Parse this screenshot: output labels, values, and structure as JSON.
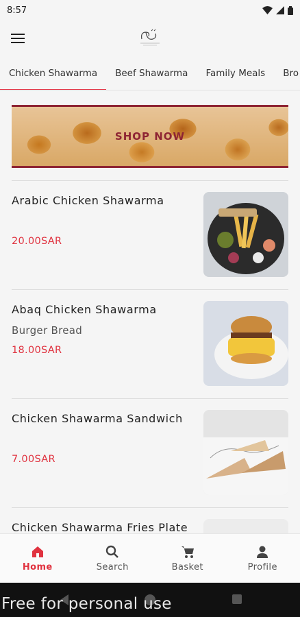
{
  "status_bar": {
    "time": "8:57"
  },
  "header": {
    "logo_icon": "brand-logo-icon",
    "menu_icon": "hamburger-menu-icon"
  },
  "tabs": [
    {
      "label": "Chicken Shawarma",
      "active": true
    },
    {
      "label": "Beef Shawarma",
      "active": false
    },
    {
      "label": "Family Meals",
      "active": false
    },
    {
      "label": "Bro",
      "active": false
    }
  ],
  "banner": {
    "label": "SHOP NOW"
  },
  "products": [
    {
      "name": "Arabic Chicken Shawarma",
      "subtitle": "",
      "price": "20.00SAR"
    },
    {
      "name": "Abaq Chicken Shawarma",
      "subtitle": "Burger Bread",
      "price": "18.00SAR"
    },
    {
      "name": "Chicken Shawarma Sandwich",
      "subtitle": "",
      "price": "7.00SAR"
    },
    {
      "name": "Chicken Shawarma Fries Plate",
      "subtitle": "",
      "price": ""
    }
  ],
  "bottom_nav": [
    {
      "label": "Home",
      "icon": "home-icon",
      "active": true
    },
    {
      "label": "Search",
      "icon": "search-icon",
      "active": false
    },
    {
      "label": "Basket",
      "icon": "cart-icon",
      "active": false
    },
    {
      "label": "Profile",
      "icon": "profile-icon",
      "active": false
    }
  ],
  "watermark": "Free for personal use",
  "colors": {
    "accent": "#e0323f",
    "banner_border": "#8e2433",
    "background": "#f5f5f5"
  }
}
